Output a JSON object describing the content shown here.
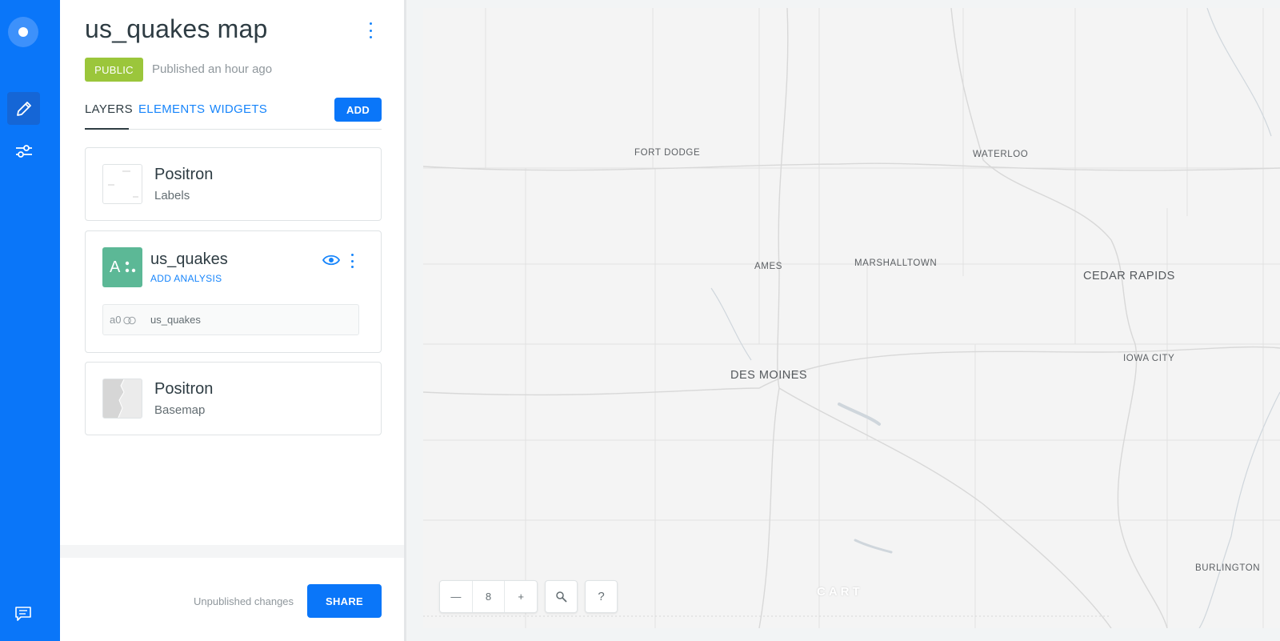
{
  "panel": {
    "title": "us_quakes map",
    "badge": "PUBLIC",
    "published": "Published an hour ago"
  },
  "tabs": [
    {
      "label": "LAYERS",
      "active": true
    },
    {
      "label": "ELEMENTS",
      "active": false
    },
    {
      "label": "WIDGETS",
      "active": false
    }
  ],
  "add_label": "ADD",
  "cards": {
    "labels_layer": {
      "title": "Positron",
      "subtitle": "Labels"
    },
    "data_layer": {
      "letter": "A",
      "name": "us_quakes",
      "add_analysis": "ADD ANALYSIS",
      "source_id": "a0",
      "source_name": "us_quakes",
      "color": "#5cb896"
    },
    "basemap": {
      "title": "Positron",
      "subtitle": "Basemap"
    }
  },
  "footer": {
    "status": "Unpublished changes",
    "share_label": "SHARE"
  },
  "map": {
    "zoom_level": "8",
    "zoom_out": "—",
    "zoom_in": "+",
    "help": "?",
    "attribution": "CART",
    "cities": {
      "fort_dodge": "FORT DODGE",
      "waterloo": "WATERLOO",
      "ames": "AMES",
      "marshalltown": "MARSHALLTOWN",
      "cedar_rapids": "CEDAR RAPIDS",
      "iowa_city": "IOWA CITY",
      "des_moines": "DES MOINES",
      "burlington": "BURLINGTON"
    }
  },
  "colors": {
    "brand": "#0a76f9",
    "public_badge": "#9bc63b",
    "link": "#1785fb"
  }
}
